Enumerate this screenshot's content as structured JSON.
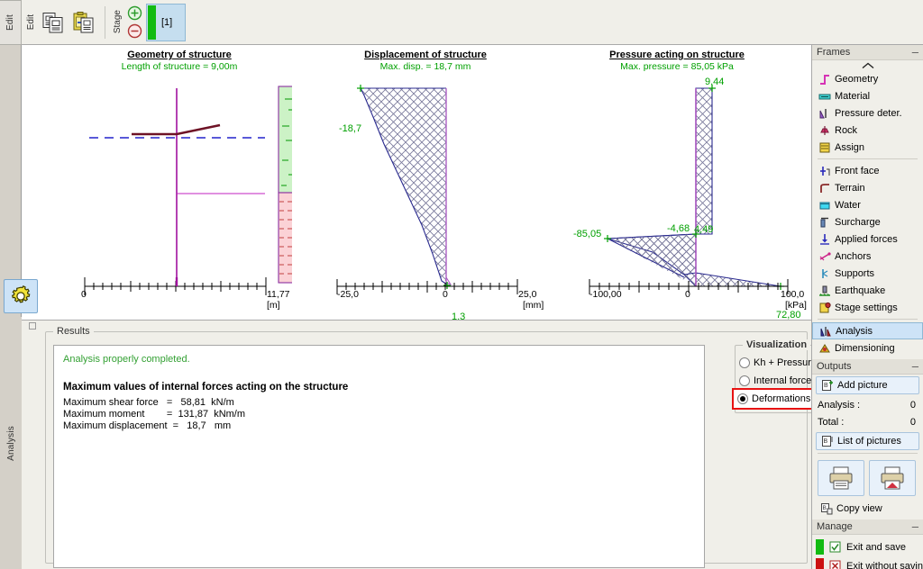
{
  "window": {
    "left_tab_top": "Edit",
    "left_tab_bottom": "Analysis",
    "gear_icon": "gear-icon"
  },
  "toolbar": {
    "edit_label": "Edit",
    "copy_icon": "copy-documents-icon",
    "paste_icon": "paste-clipboard-icon",
    "stage_label": "Stage",
    "add_stage_icon": "plus-circle-icon",
    "remove_stage_icon": "minus-circle-icon",
    "stage_chip_label": "[1]",
    "stage_chip_color": "#12bb12"
  },
  "charts": [
    {
      "title": "Geometry of structure",
      "subtitle": "Length of structure = 9,00m",
      "axis_min": "0",
      "axis_max": "11,77",
      "unit": "[m]"
    },
    {
      "title": "Displacement of structure",
      "subtitle": "Max. disp. = 18,7 mm",
      "axis_min": "-25,0",
      "axis_mid": "0",
      "axis_max": "25,0",
      "unit": "[mm]",
      "labels": [
        "-18,7",
        "1,3"
      ]
    },
    {
      "title": "Pressure acting on structure",
      "subtitle": "Max. pressure = 85,05 kPa",
      "axis_min": "-100,00",
      "axis_mid": "0",
      "axis_max": "100,0",
      "unit": "[kPa]",
      "labels": [
        "9,44",
        "-4,68",
        "4,49",
        "-85,05",
        "72,80"
      ]
    }
  ],
  "chart_data": [
    {
      "type": "line",
      "title": "Geometry of structure",
      "subtitle": "Length of structure = 9,00m",
      "xlabel": "[m]",
      "ylabel": "",
      "xlim": [
        0,
        11.77
      ],
      "xticks": [
        "0",
        "11,77"
      ],
      "grid": false,
      "legend": "none",
      "annotations": [
        "Sheeting wall length = 9,00 m",
        "Terrain line (dark red) slopes up to the right",
        "Blue dashed line = ground water table",
        "Magenta horizontal line = excavation / construction depth",
        "Soil profile column: upper green layer, lower pink layer"
      ],
      "series": [
        {
          "name": "wall",
          "color": "#a0119e",
          "x": [
            5.75,
            5.75
          ],
          "y": [
            9.0,
            0.0
          ]
        },
        {
          "name": "terrain",
          "color": "#7a1020",
          "x": [
            2.8,
            5.75,
            8.4
          ],
          "y": [
            9.0,
            9.0,
            9.55
          ]
        },
        {
          "name": "water-table",
          "color": "#2222cc",
          "x": [
            0.6,
            9.4
          ],
          "y": [
            6.6,
            6.6
          ]
        },
        {
          "name": "excavation",
          "color": "#c020c0",
          "x": [
            5.75,
            9.4
          ],
          "y": [
            3.4,
            3.4
          ]
        }
      ],
      "soil_layers": [
        {
          "name": "upper-layer",
          "color": "#c9f3c4",
          "top": 9.6,
          "bottom": 4.2
        },
        {
          "name": "lower-layer",
          "color": "#fad0d4",
          "top": 4.2,
          "bottom": 0.0
        }
      ]
    },
    {
      "type": "area",
      "title": "Displacement of structure",
      "subtitle": "Max. disp. = 18,7 mm",
      "xlabel": "[mm]",
      "ylabel": "",
      "xlim": [
        -25.0,
        25.0
      ],
      "xticks": [
        "-25,0",
        "0",
        "25,0"
      ],
      "grid": false,
      "legend": "none",
      "data_labels": [
        {
          "text": "-18,7",
          "x": -18.7,
          "y": 9.0
        },
        {
          "text": "1,3",
          "x": 1.3,
          "y": 0.0
        }
      ],
      "series": [
        {
          "name": "displacement",
          "color": "#2b2b8f",
          "y": [
            9.0,
            8.1,
            7.2,
            6.3,
            5.4,
            4.5,
            3.6,
            2.7,
            1.8,
            0.9,
            0.45,
            0.0
          ],
          "values": [
            -18.7,
            -16.7,
            -14.6,
            -12.5,
            -10.4,
            -8.3,
            -6.3,
            -4.3,
            -2.5,
            -0.9,
            -0.1,
            1.3
          ]
        }
      ]
    },
    {
      "type": "area",
      "title": "Pressure acting on structure",
      "subtitle": "Max. pressure = 85,05 kPa",
      "xlabel": "[kPa]",
      "ylabel": "",
      "xlim": [
        -100.0,
        100.0
      ],
      "xticks": [
        "-100,00",
        "0",
        "100,0"
      ],
      "grid": false,
      "legend": "none",
      "data_labels": [
        {
          "text": "9,44",
          "x": 9.44,
          "y": 9.0
        },
        {
          "text": "-4,68",
          "x": -4.68,
          "y": 3.55
        },
        {
          "text": "4,49",
          "x": 4.49,
          "y": 3.55
        },
        {
          "text": "-85,05",
          "x": -85.05,
          "y": 3.4
        },
        {
          "text": "72,80",
          "x": 72.8,
          "y": 0.0
        }
      ],
      "series": [
        {
          "name": "pressure",
          "color": "#2b2b8f",
          "y": [
            9.0,
            3.6,
            3.55,
            3.4,
            2.0,
            1.4,
            0.0
          ],
          "values": [
            9.44,
            9.44,
            4.49,
            -85.05,
            -40.0,
            0.0,
            72.8
          ]
        }
      ]
    }
  ],
  "results": {
    "group_title": "Results",
    "status": "Analysis properly completed.",
    "heading": "Maximum values of internal forces acting on the structure",
    "lines": [
      "Maximum shear force   =   58,81  kN/m",
      "Maximum moment        =  131,87  kNm/m",
      "Maximum displacement  =   18,7   mm"
    ]
  },
  "visualization": {
    "group_title": "Visualization",
    "options": [
      {
        "label": "Kh + Pressures",
        "selected": false
      },
      {
        "label": "Internal forces",
        "selected": false
      },
      {
        "label": "Deformations + stresses",
        "selected": true
      }
    ],
    "highlight_color": "#e81313"
  },
  "sidebar": {
    "frames": {
      "title": "Frames",
      "minimize": "–",
      "collapse_icon": "chevron-up-icon",
      "items": [
        {
          "label": "Geometry",
          "icon": "geometry-icon",
          "selected": false
        },
        {
          "label": "Material",
          "icon": "material-icon",
          "selected": false
        },
        {
          "label": "Pressure deter.",
          "icon": "pressure-determination-icon",
          "selected": false
        },
        {
          "label": "Rock",
          "icon": "rock-icon",
          "selected": false
        },
        {
          "label": "Assign",
          "icon": "assign-icon",
          "selected": false
        },
        {
          "label": "Front face",
          "icon": "front-face-icon",
          "selected": false
        },
        {
          "label": "Terrain",
          "icon": "terrain-icon",
          "selected": false
        },
        {
          "label": "Water",
          "icon": "water-icon",
          "selected": false
        },
        {
          "label": "Surcharge",
          "icon": "surcharge-icon",
          "selected": false
        },
        {
          "label": "Applied forces",
          "icon": "applied-forces-icon",
          "selected": false
        },
        {
          "label": "Anchors",
          "icon": "anchors-icon",
          "selected": false
        },
        {
          "label": "Supports",
          "icon": "supports-icon",
          "selected": false
        },
        {
          "label": "Earthquake",
          "icon": "earthquake-icon",
          "selected": false
        },
        {
          "label": "Stage settings",
          "icon": "stage-settings-icon",
          "selected": false
        },
        {
          "label": "Analysis",
          "icon": "analysis-icon",
          "selected": true
        },
        {
          "label": "Dimensioning",
          "icon": "dimensioning-icon",
          "selected": false
        }
      ]
    },
    "outputs": {
      "title": "Outputs",
      "minimize": "–",
      "add_picture": "Add picture",
      "add_picture_icon": "add-picture-icon",
      "analysis_label": "Analysis :",
      "analysis_count": "0",
      "total_label": "Total :",
      "total_count": "0",
      "list_of_pictures": "List of pictures",
      "list_of_pictures_icon": "list-of-pictures-icon",
      "print_icon": "printer-icon",
      "print_report_icon": "printer-report-icon",
      "copy_view": "Copy view",
      "copy_view_icon": "copy-view-icon"
    },
    "manage": {
      "title": "Manage",
      "minimize": "–",
      "exit_save": "Exit and save",
      "exit_save_color": "#12bb12",
      "exit_save_icon": "check-box-icon",
      "exit_nosave": "Exit without saving",
      "exit_nosave_color": "#cc1111",
      "exit_nosave_icon": "cross-box-icon"
    }
  }
}
